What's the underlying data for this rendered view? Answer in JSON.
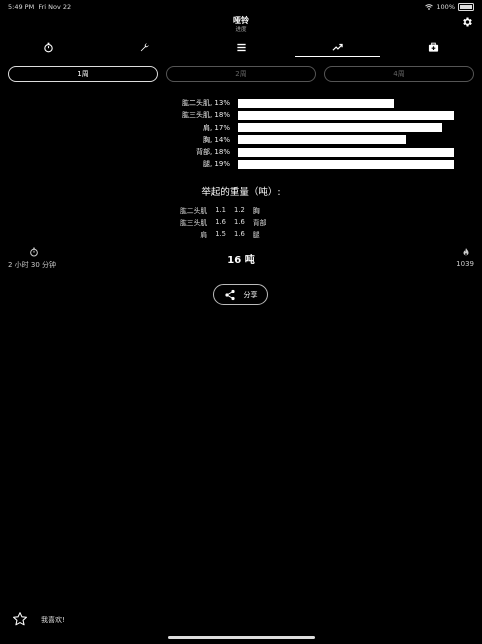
{
  "status_bar": {
    "time": "5:49 PM",
    "date": "Fri Nov 22",
    "battery": "100%"
  },
  "header": {
    "title": "哑铃",
    "subtitle": "进度"
  },
  "tabs": [
    {
      "icon": "stopwatch-icon",
      "active": false
    },
    {
      "icon": "wrench-icon",
      "active": false
    },
    {
      "icon": "list-icon",
      "active": false
    },
    {
      "icon": "trend-icon",
      "active": true
    },
    {
      "icon": "medical-case-icon",
      "active": false
    }
  ],
  "segments": [
    "1周",
    "2周",
    "4周"
  ],
  "chart_data": {
    "type": "bar",
    "orientation": "horizontal",
    "categories": [
      "肱二头肌, 13%",
      "肱三头肌, 18%",
      "肩, 17%",
      "胸, 14%",
      "背部, 18%",
      "腿, 19%"
    ],
    "values": [
      13,
      18,
      17,
      14,
      18,
      19
    ],
    "xlim": [
      0,
      18
    ],
    "title": "",
    "xlabel": "",
    "ylabel": ""
  },
  "weight": {
    "title": "举起的重量（吨）:",
    "rows": [
      [
        "肱二头肌",
        "1.1",
        "1.2",
        "胸"
      ],
      [
        "肱三头肌",
        "1.6",
        "1.6",
        "背部"
      ],
      [
        "肩",
        "1.5",
        "1.6",
        "腿"
      ]
    ]
  },
  "stats": {
    "duration": "2 小时 30 分钟",
    "total": "16 吨",
    "calories": "1039"
  },
  "share_label": "分享",
  "like_label": "我喜欢!"
}
